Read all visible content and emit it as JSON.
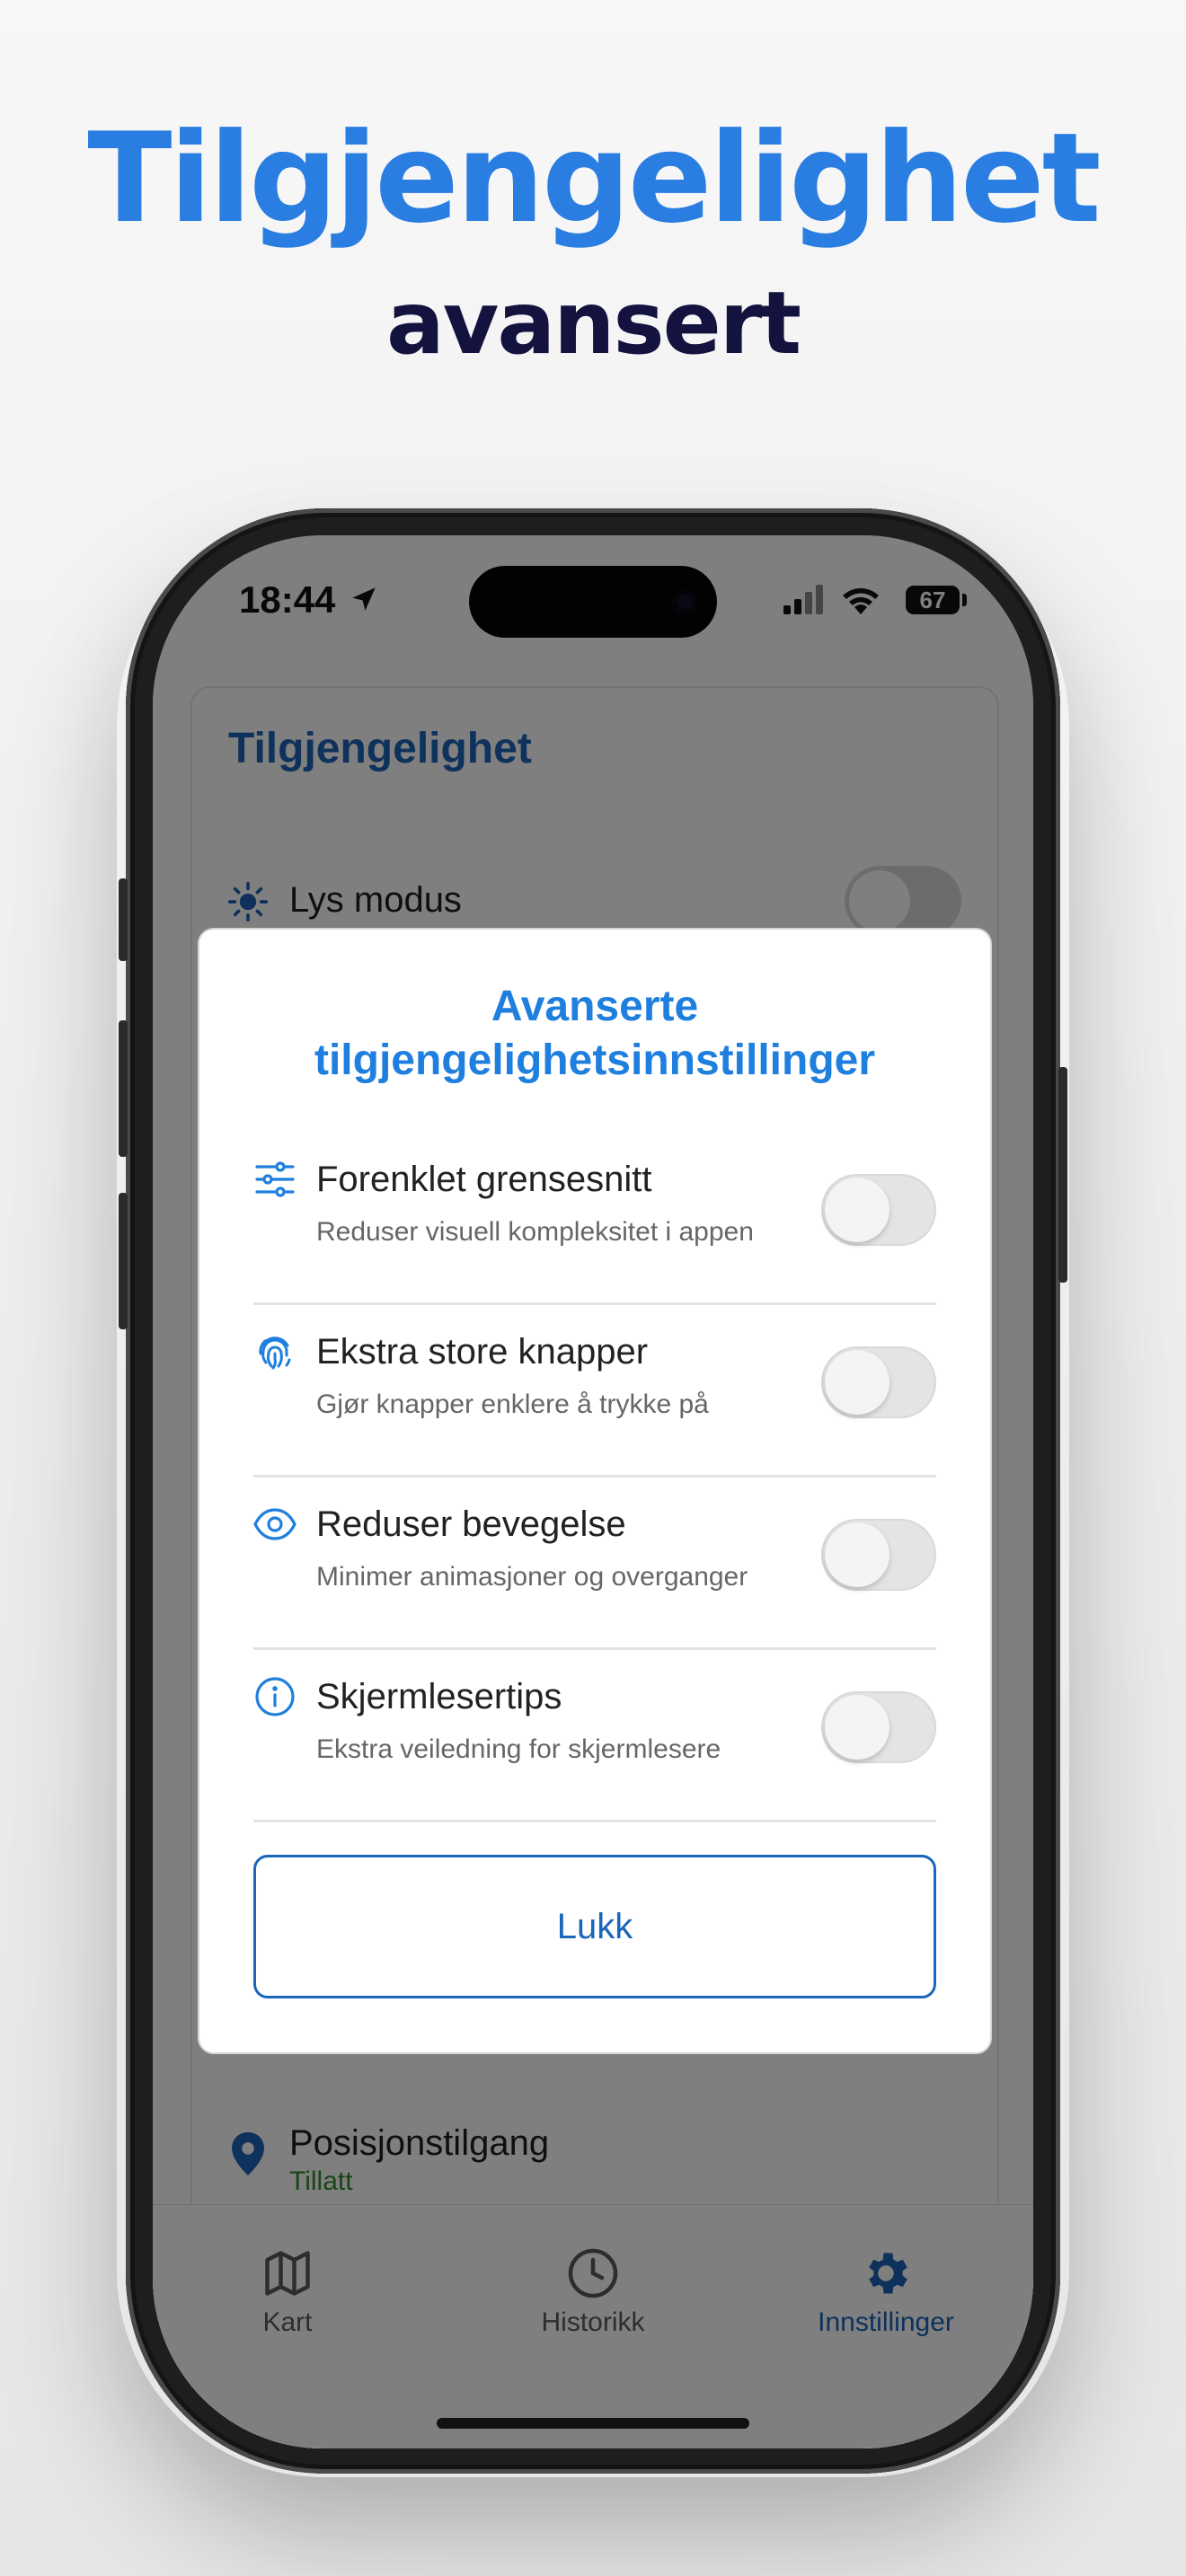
{
  "promo": {
    "headline": "Tilgjengelighet",
    "subheadline": "avansert",
    "headline_color": "#2a7de1",
    "subheadline_color": "#14123f"
  },
  "status_bar": {
    "time": "18:44",
    "battery": "67",
    "icons": [
      "location-arrow-icon",
      "cellular-signal-icon",
      "wifi-icon",
      "battery-icon"
    ]
  },
  "settings_card": {
    "title": "Tilgjengelighet",
    "rows": [
      {
        "icon": "sun-icon",
        "label": "Lys modus",
        "toggle_on": false
      },
      {
        "icon": "location-pin-icon",
        "label": "Posisjonstilgang",
        "sublabel": "Tillatt"
      }
    ]
  },
  "modal": {
    "title_line1": "Avanserte",
    "title_line2": "tilgjengelighetsinnstillinger",
    "title_color": "#1f7fde",
    "options": [
      {
        "icon": "sliders-icon",
        "label": "Forenklet grensesnitt",
        "description": "Reduser visuell kompleksitet i appen",
        "toggle_on": false
      },
      {
        "icon": "fingerprint-icon",
        "label": "Ekstra store knapper",
        "description": "Gjør knapper enklere å trykke på",
        "toggle_on": false
      },
      {
        "icon": "eye-icon",
        "label": "Reduser bevegelse",
        "description": "Minimer animasjoner og overganger",
        "toggle_on": false
      },
      {
        "icon": "info-icon",
        "label": "Skjermlesertips",
        "description": "Ekstra veiledning for skjermlesere",
        "toggle_on": false
      }
    ],
    "close_label": "Lukk",
    "accent_color": "#1a66ba"
  },
  "tab_bar": {
    "tabs": [
      {
        "icon": "map-icon",
        "label": "Kart",
        "active": false
      },
      {
        "icon": "clock-icon",
        "label": "Historikk",
        "active": false
      },
      {
        "icon": "gear-icon",
        "label": "Innstillinger",
        "active": true
      }
    ]
  }
}
